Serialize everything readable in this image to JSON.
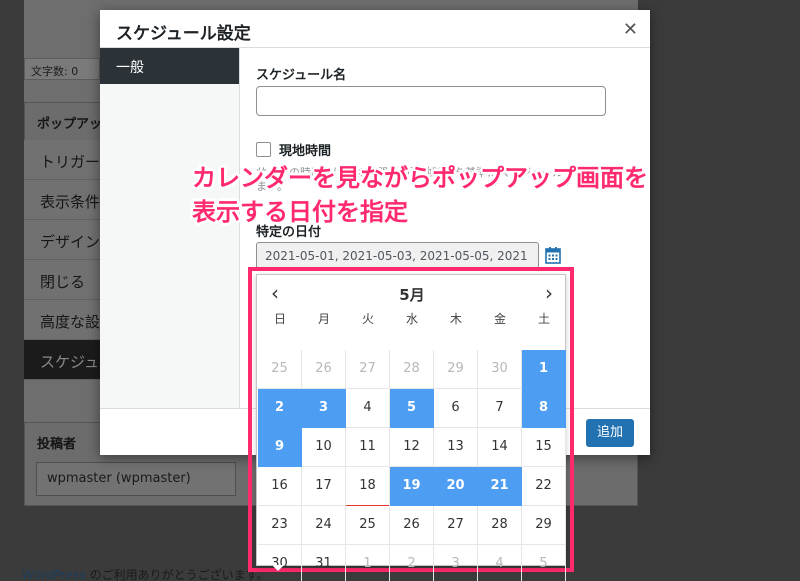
{
  "background": {
    "word_count_label": "文字数: 0",
    "popup_box_title": "ポップアップ",
    "tabs": [
      "トリガー",
      "表示条件",
      "デザイン",
      "閉じる",
      "高度な設",
      "スケジュ"
    ],
    "author_box_title": "投稿者",
    "author_value": "wpmaster (wpmaster)",
    "footer_link": "WordPress",
    "footer_text": " のご利用ありがとうございます。"
  },
  "modal": {
    "title": "スケジュール設定",
    "close_glyph": "✕",
    "sidebar_items": [
      "一般"
    ],
    "schedule_name_label": "スケジュール名",
    "schedule_name_value": "",
    "local_time_label": "現地時間",
    "local_time_desc": "サイトの時間ではなく訪問者の現地時間を基準にスケジュールを適用します。",
    "specific_date_label": "特定の日付",
    "specific_date_value": "2021-05-01, 2021-05-03, 2021-05-05, 2021",
    "add_button": "追加"
  },
  "callout": {
    "line1": "カレンダーを見ながらポップアップ画面を",
    "line2": "表示する日付を指定"
  },
  "calendar": {
    "month_label": "5月",
    "prev_glyph": "‹",
    "next_glyph": "›",
    "weekdays": [
      "日",
      "月",
      "火",
      "水",
      "木",
      "金",
      "土"
    ],
    "weeks": [
      [
        {
          "d": "25",
          "other": true
        },
        {
          "d": "26",
          "other": true
        },
        {
          "d": "27",
          "other": true
        },
        {
          "d": "28",
          "other": true
        },
        {
          "d": "29",
          "other": true
        },
        {
          "d": "30",
          "other": true
        },
        {
          "d": "1",
          "sel": true
        }
      ],
      [
        {
          "d": "2",
          "sel": true
        },
        {
          "d": "3",
          "sel": true
        },
        {
          "d": "4"
        },
        {
          "d": "5",
          "sel": true
        },
        {
          "d": "6"
        },
        {
          "d": "7"
        },
        {
          "d": "8",
          "sel": true
        }
      ],
      [
        {
          "d": "9",
          "sel": true
        },
        {
          "d": "10"
        },
        {
          "d": "11"
        },
        {
          "d": "12"
        },
        {
          "d": "13"
        },
        {
          "d": "14"
        },
        {
          "d": "15"
        }
      ],
      [
        {
          "d": "16"
        },
        {
          "d": "17"
        },
        {
          "d": "18",
          "today": true
        },
        {
          "d": "19",
          "sel": true
        },
        {
          "d": "20",
          "sel": true
        },
        {
          "d": "21",
          "sel": true
        },
        {
          "d": "22"
        }
      ],
      [
        {
          "d": "23"
        },
        {
          "d": "24"
        },
        {
          "d": "25"
        },
        {
          "d": "26"
        },
        {
          "d": "27"
        },
        {
          "d": "28"
        },
        {
          "d": "29"
        }
      ],
      [
        {
          "d": "30"
        },
        {
          "d": "31"
        },
        {
          "d": "1",
          "other": true
        },
        {
          "d": "2",
          "other": true
        },
        {
          "d": "3",
          "other": true
        },
        {
          "d": "4",
          "other": true
        },
        {
          "d": "5",
          "other": true
        }
      ]
    ]
  },
  "colors": {
    "selected_day": "#4d9df2",
    "highlight": "#ff2a6d",
    "primary_button": "#2271b1"
  }
}
